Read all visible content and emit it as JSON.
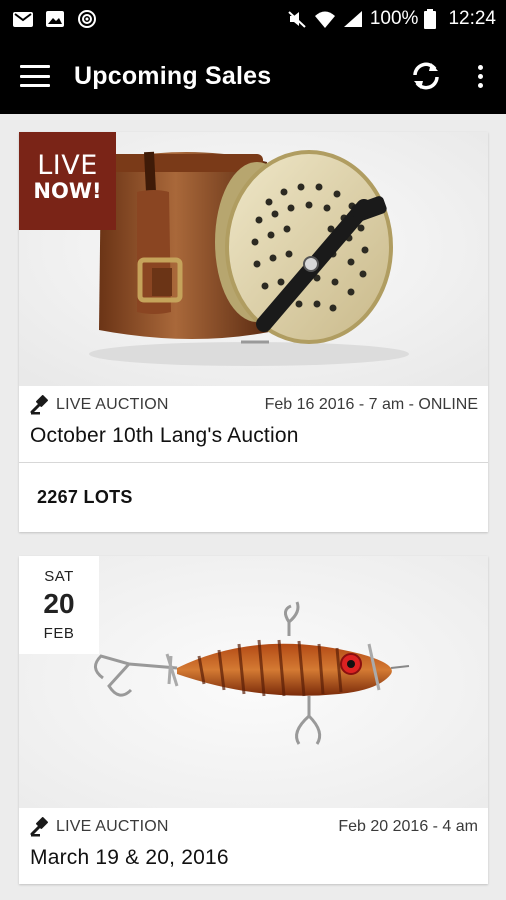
{
  "status_bar": {
    "battery": "100%",
    "time": "12:24",
    "left_icons": [
      "gmail-icon",
      "gallery-icon",
      "target-icon"
    ],
    "right_icons": [
      "mute-icon",
      "wifi-icon",
      "signal-icon",
      "battery-icon"
    ]
  },
  "app_bar": {
    "title": "Upcoming Sales",
    "icons": [
      "menu-icon",
      "refresh-icon",
      "more-vert-icon"
    ]
  },
  "sales": [
    {
      "badge_line1": "LIVE",
      "badge_line2": "NOW!",
      "badge_color": "#7a2417",
      "type_label": "LIVE AUCTION",
      "type_icon": "gavel-icon",
      "date": "Feb 16 2016 - 7 am - ONLINE",
      "title": "October 10th Lang's Auction",
      "lots": "2267 LOTS",
      "image": "fly-reel-with-leather-case"
    },
    {
      "badge_dow": "SAT",
      "badge_day": "20",
      "badge_month": "FEB",
      "type_label": "LIVE AUCTION",
      "type_icon": "gavel-icon",
      "date": "Feb 20 2016 - 4 am",
      "title": "March 19 & 20, 2016",
      "image": "fishing-lure"
    }
  ]
}
